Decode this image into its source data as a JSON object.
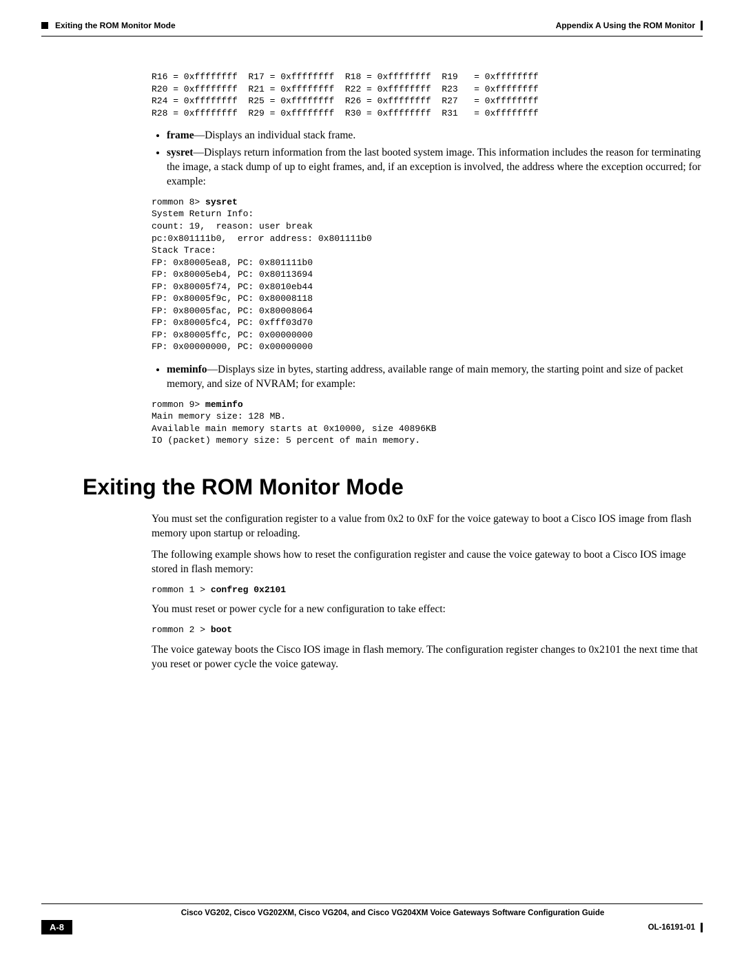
{
  "header": {
    "left_section": "Exiting the ROM Monitor Mode",
    "right_appendix": "Appendix A     Using the ROM Monitor"
  },
  "registers_block": "R16 = 0xffffffff  R17 = 0xffffffff  R18 = 0xffffffff  R19   = 0xffffffff\nR20 = 0xffffffff  R21 = 0xffffffff  R22 = 0xffffffff  R23   = 0xffffffff\nR24 = 0xffffffff  R25 = 0xffffffff  R26 = 0xffffffff  R27   = 0xffffffff\nR28 = 0xffffffff  R29 = 0xffffffff  R30 = 0xffffffff  R31   = 0xffffffff",
  "bullets": {
    "frame": {
      "term": "frame",
      "text": "—Displays an individual stack frame."
    },
    "sysret": {
      "term": "sysret",
      "text": "—Displays return information from the last booted system image. This information includes the reason for terminating the image, a stack dump of up to eight frames, and, if an exception is involved, the address where the exception occurred; for example:"
    },
    "meminfo": {
      "term": "meminfo",
      "text": "—Displays size in bytes, starting address, available range of main memory, the starting point and size of packet memory, and size of NVRAM; for example:"
    }
  },
  "sysret_block_pre": "rommon 8> ",
  "sysret_block_cmd": "sysret",
  "sysret_block_post": "\nSystem Return Info:\ncount: 19,  reason: user break\npc:0x801111b0,  error address: 0x801111b0\nStack Trace:\nFP: 0x80005ea8, PC: 0x801111b0\nFP: 0x80005eb4, PC: 0x80113694\nFP: 0x80005f74, PC: 0x8010eb44\nFP: 0x80005f9c, PC: 0x80008118\nFP: 0x80005fac, PC: 0x80008064\nFP: 0x80005fc4, PC: 0xfff03d70\nFP: 0x80005ffc, PC: 0x00000000\nFP: 0x00000000, PC: 0x00000000",
  "meminfo_block_pre": "rommon 9> ",
  "meminfo_block_cmd": "meminfo",
  "meminfo_block_post": "\nMain memory size: 128 MB.\nAvailable main memory starts at 0x10000, size 40896KB\nIO (packet) memory size: 5 percent of main memory.",
  "section_title": "Exiting the ROM Monitor Mode",
  "para1": "You must set the configuration register to a value from 0x2 to 0xF for the voice gateway to boot a Cisco IOS image from flash memory upon startup or reloading.",
  "para2": "The following example shows how to reset the configuration register and cause the voice gateway to boot a Cisco IOS image stored in flash memory:",
  "confreg_pre": "rommon 1 > ",
  "confreg_cmd": "confreg 0x2101",
  "para3": "You must reset or power cycle for a new configuration to take effect:",
  "boot_pre": "rommon 2 > ",
  "boot_cmd": "boot",
  "para4": "The voice gateway boots the Cisco IOS image in flash memory. The configuration register changes to 0x2101 the next time that you reset or power cycle the voice gateway.",
  "footer": {
    "title": "Cisco VG202, Cisco VG202XM, Cisco VG204, and Cisco VG204XM Voice Gateways Software Configuration Guide",
    "page": "A-8",
    "docnum": "OL-16191-01"
  }
}
